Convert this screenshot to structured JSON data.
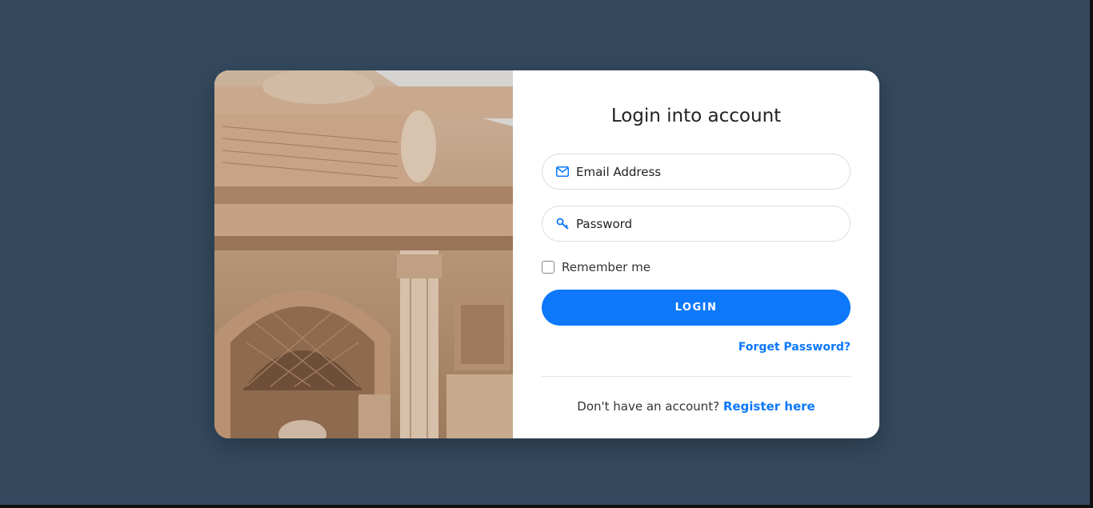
{
  "login": {
    "title": "Login into account",
    "email": {
      "placeholder": "Email Address",
      "icon": "envelope-icon"
    },
    "password": {
      "placeholder": "Password",
      "icon": "key-icon"
    },
    "remember_label": "Remember me",
    "remember_checked": false,
    "login_button": "LOGIN",
    "forgot_link": "Forget Password?",
    "register_prompt": "Don't have an account?",
    "register_link": "Register here"
  },
  "colors": {
    "background": "#34495e",
    "accent": "#0d78fa",
    "card": "#ffffff"
  }
}
